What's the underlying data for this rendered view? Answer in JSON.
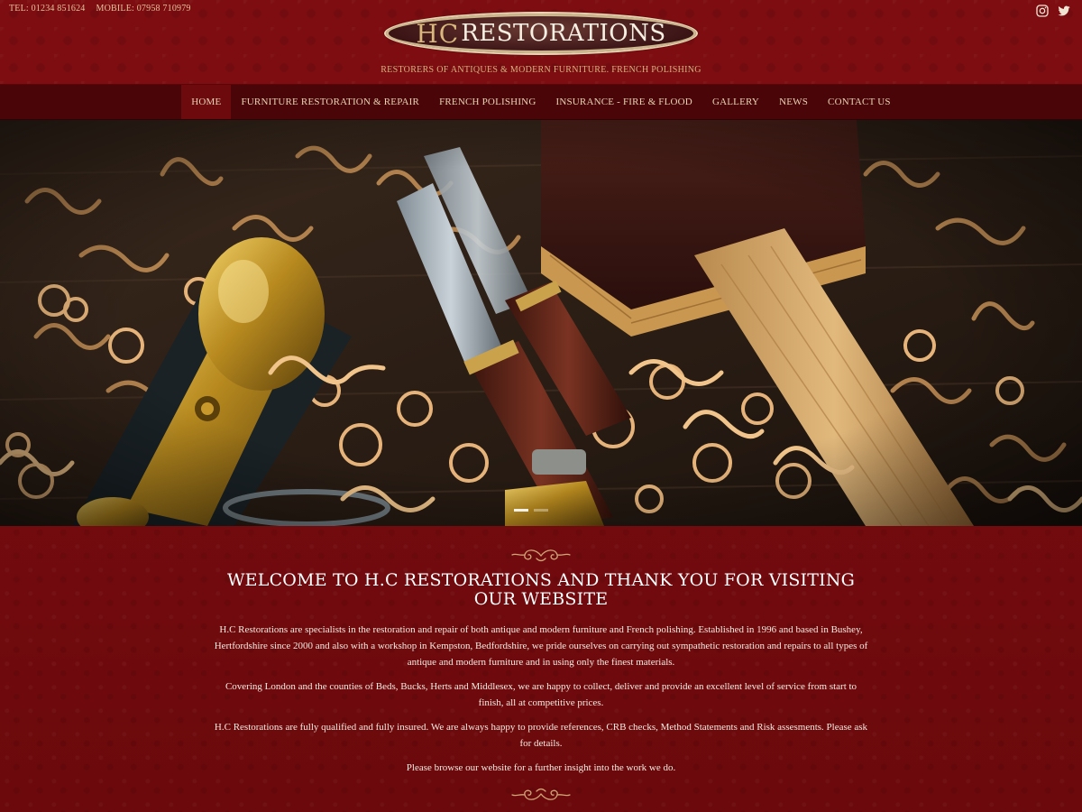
{
  "header": {
    "tel": "TEL: 01234 851624",
    "mobile": "MOBILE: 07958 710979",
    "logo_hc": "HC",
    "logo_rest": "RESTORATIONS",
    "tagline": "RESTORERS OF ANTIQUES & MODERN FURNITURE. FRENCH POLISHING",
    "social": [
      "instagram-icon",
      "twitter-icon"
    ]
  },
  "nav": {
    "items": [
      "HOME",
      "FURNITURE RESTORATION & REPAIR",
      "FRENCH POLISHING",
      "INSURANCE - FIRE & FLOOD",
      "GALLERY",
      "NEWS",
      "CONTACT US"
    ],
    "active": "HOME"
  },
  "slider": {
    "dots": 2,
    "active_dot": 1
  },
  "main": {
    "heading": "WELCOME TO H.C RESTORATIONS AND THANK YOU FOR VISITING OUR WEBSITE",
    "paragraphs": [
      "H.C Restorations are specialists in the restoration and repair of both antique and modern furniture and French polishing. Established in 1996 and based in Bushey, Hertfordshire since 2000 and also with a workshop in Kempston, Bedfordshire, we pride ourselves on carrying out sympathetic restoration and repairs to all types of antique and modern furniture and in using only the finest materials.",
      "Covering London and the counties of Beds, Bucks, Herts and Middlesex, we are happy to collect, deliver and provide an excellent level of service from start to finish, all at competitive prices.",
      "H.C Restorations are fully qualified and fully insured. We are always happy to provide references, CRB checks, Method Statements and Risk assesments. Please ask for details.",
      "Please browse our website for a further insight into the work we do."
    ]
  },
  "colors": {
    "background": "#6e0a0d",
    "nav": "#4a0508",
    "nav_active": "#6c0a0e",
    "gold": "#d9b77d",
    "text": "#f5ebe0"
  }
}
